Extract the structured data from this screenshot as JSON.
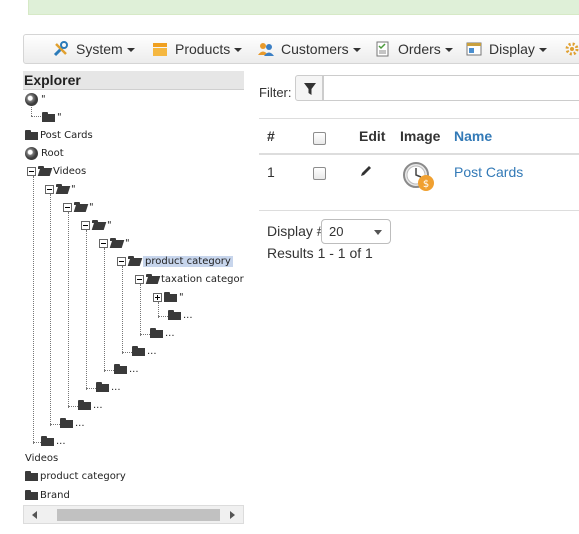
{
  "menu": [
    {
      "label": "System",
      "icon": "wrench-screwdriver-icon"
    },
    {
      "label": "Products",
      "icon": "products-box-icon"
    },
    {
      "label": "Customers",
      "icon": "customers-users-icon"
    },
    {
      "label": "Orders",
      "icon": "orders-checklist-icon"
    },
    {
      "label": "Display",
      "icon": "display-window-icon"
    }
  ],
  "explorer": {
    "title": "Explorer",
    "tree": {
      "quote": "\"",
      "ellipsis": "...",
      "post_cards": "Post Cards",
      "root": "Root",
      "videos": "Videos",
      "product_category": "product category",
      "taxation_category": "taxation category",
      "videos_footer": "Videos",
      "product_category_footer": "product category",
      "brand": "Brand"
    }
  },
  "filter": {
    "label": "Filter:",
    "value": "",
    "placeholder": ""
  },
  "table": {
    "headers": {
      "num": "#",
      "edit": "Edit",
      "image": "Image",
      "name": "Name"
    },
    "rows": [
      {
        "num": "1",
        "name": "Post Cards",
        "image_icon": "clock-coin-icon"
      }
    ]
  },
  "pagination": {
    "display_label": "Display #",
    "per_page": "20",
    "results": "Results 1 - 1 of 1"
  },
  "colors": {
    "link": "#337ab7",
    "selection": "#c7d5ec",
    "banner": "#dff0d8"
  }
}
